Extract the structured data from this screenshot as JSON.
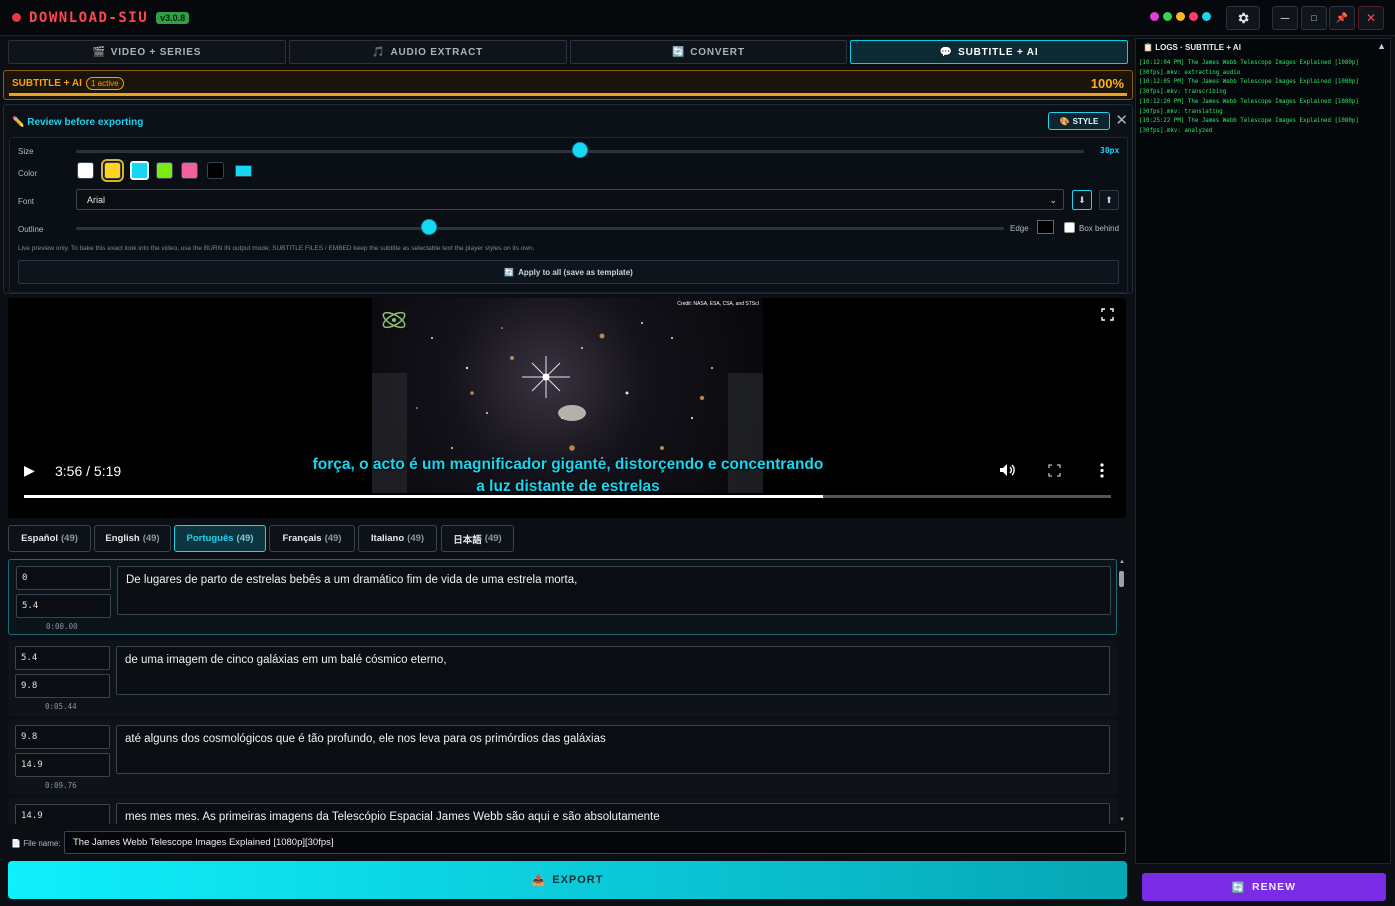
{
  "app": {
    "title": "DOWNLOAD-SIU",
    "version": "v3.0.8",
    "status_dots": [
      "#e23ed8",
      "#39d353",
      "#f7b924",
      "#ff3b6b",
      "#1fd2ee"
    ]
  },
  "window": {
    "minimize": "─",
    "maximize": "□",
    "pin": "📌",
    "close": "✕"
  },
  "tabs": [
    {
      "label": "VIDEO + SERIES",
      "icon": "🎬"
    },
    {
      "label": "AUDIO EXTRACT",
      "icon": "🎵"
    },
    {
      "label": "CONVERT",
      "icon": "🔄"
    },
    {
      "label": "SUBTITLE + AI",
      "icon": "💬"
    }
  ],
  "progress": {
    "label": "SUBTITLE + AI",
    "badge": "1 active",
    "percent_text": "100%",
    "value": 1.0,
    "color": "#f0a020"
  },
  "review": {
    "title": "Review before exporting",
    "style_button": "STYLE",
    "close": "✕",
    "size_label": "Size",
    "size_value": "30px",
    "size_fraction": 0.5,
    "color_label": "Color",
    "colors": [
      "#ffffff",
      "#ffd21f",
      "#17d6f0",
      "#7bea13",
      "#f0609c",
      "#000000"
    ],
    "selected_color": "#17d6f0",
    "custom_color": "#17d6f0",
    "font_label": "Font",
    "font_value": "Arial",
    "outline_label": "Outline",
    "outline_fraction": 0.38,
    "edge_label": "Edge",
    "box_behind_label": "Box behind",
    "hint": "Live preview only. To bake this exact look into the video, use the BURN IN output mode; SUBTITLE FILES / EMBED keep the subtitle as selectable text the player styles on its own.",
    "apply_button": "Apply to all (save as template)"
  },
  "video": {
    "credit": "Credit: NASA, ESA, CSA, and STScI",
    "time": "3:56 / 5:19",
    "progress_fraction": 0.735,
    "subtitle_line1": "força, o acto é um magnificador gigante, distorçendo e concentrando",
    "subtitle_line2": "a luz distante de estrelas"
  },
  "languages": [
    {
      "name": "Español",
      "count": "(49)"
    },
    {
      "name": "English",
      "count": "(49)"
    },
    {
      "name": "Português",
      "count": "(49)"
    },
    {
      "name": "Français",
      "count": "(49)"
    },
    {
      "name": "Italiano",
      "count": "(49)"
    },
    {
      "name": "日本語",
      "count": "(49)"
    }
  ],
  "segments": [
    {
      "start": "0",
      "end": "5.4",
      "stamp": "0:00.00",
      "text": "De lugares de parto de estrelas bebês a um dramático fim de vida de uma estrela morta,"
    },
    {
      "start": "5.4",
      "end": "9.8",
      "stamp": "0:05.44",
      "text": "de uma imagem de cinco galáxias em um balé cósmico eterno,"
    },
    {
      "start": "9.8",
      "end": "14.9",
      "stamp": "0:09.76",
      "text": "até alguns dos cosmológicos que é tão profundo, ele nos leva para os primórdios das galáxias"
    },
    {
      "start": "14.9",
      "end": "",
      "stamp": "",
      "text": "mes mes mes. As primeiras imagens da Telescópio Espacial James Webb são aqui e são absolutamente"
    }
  ],
  "footer": {
    "file_label": "File name:",
    "file_value": "The James Webb Telescope Images Explained [1080p][30fps]",
    "export_button": "EXPORT"
  },
  "logs": {
    "title": "LOGS · SUBTITLE + AI",
    "lines": [
      "[10:12:04 PM] The James Webb Telescope Images Explained [1080p][30fps].mkv: extracting_audio",
      "[10:12:05 PM] The James Webb Telescope Images Explained [1080p][30fps].mkv: transcribing",
      "[10:12:20 PM] The James Webb Telescope Images Explained [1080p][30fps].mkv: translating",
      "[10:25:22 PM] The James Webb Telescope Images Explained [1080p][30fps].mkv: analyzed"
    ],
    "renew_button": "RENEW"
  }
}
